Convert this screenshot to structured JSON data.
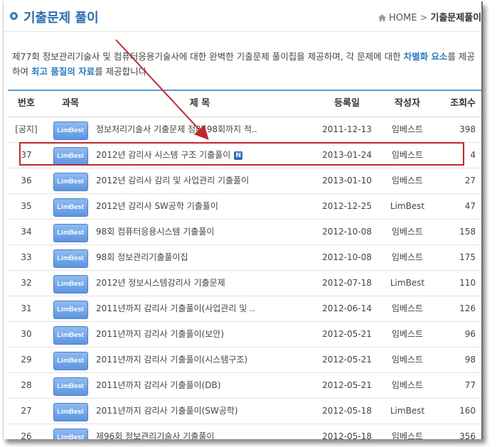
{
  "header": {
    "title": "기출문제 풀이",
    "breadcrumb_home": "HOME",
    "breadcrumb_sep": ">",
    "breadcrumb_current": "기출문제풀이"
  },
  "intro": {
    "line1_a": "제77회 정보관리기술사 및 컴퓨터응용기술사에 대한 완벽한 기출문제 풀이집을 제공하며, 각 문제에 대한 ",
    "line1_hl": "차별화 요소",
    "line1_b": "를 제공",
    "line2_a": "하여 ",
    "line2_hl": "최고 품질의 자료",
    "line2_b": "를 제공합니다."
  },
  "table": {
    "headers": {
      "no": "번호",
      "subject": "과목",
      "title": "제 목",
      "date": "등록일",
      "author": "작성자",
      "views": "조회수"
    },
    "rows": [
      {
        "no": "[공지]",
        "badge": "LimBest",
        "title": "정보처리기술사 기출문제 정리(98회까지 적..",
        "date": "2011-12-13",
        "author": "임베스트",
        "views": "398"
      },
      {
        "no": "37",
        "badge": "LimBest",
        "title": "2012년 감리사 시스템 구조 기출풀이",
        "new": "N",
        "date": "2013-01-24",
        "author": "임베스트",
        "views": "4"
      },
      {
        "no": "36",
        "badge": "LimBest",
        "title": "2012년 감리사 감리 및 사업관리 기출풀이",
        "date": "2013-01-10",
        "author": "임베스트",
        "views": "27"
      },
      {
        "no": "35",
        "badge": "LimBest",
        "title": "2012년 감리사 SW공학 기출풀이",
        "date": "2012-12-25",
        "author": "LimBest",
        "views": "47"
      },
      {
        "no": "34",
        "badge": "LimBest",
        "title": "98회 컴퓨터응용시스템 기출풀이",
        "date": "2012-10-08",
        "author": "임베스트",
        "views": "158"
      },
      {
        "no": "33",
        "badge": "LimBest",
        "title": "98회 정보관리기출풀이집",
        "date": "2012-10-08",
        "author": "임베스트",
        "views": "175"
      },
      {
        "no": "32",
        "badge": "LimBest",
        "title": "2012년 정보시스템감리사 기출문제",
        "date": "2012-07-18",
        "author": "LimBest",
        "views": "110"
      },
      {
        "no": "31",
        "badge": "LimBest",
        "title": "2011년까지 감리사 기출풀이(사업관리 및 ..",
        "date": "2012-06-14",
        "author": "임베스트",
        "views": "126"
      },
      {
        "no": "30",
        "badge": "LimBest",
        "title": "2011년까지 감리사 기출풀이(보안)",
        "date": "2012-05-21",
        "author": "임베스트",
        "views": "96"
      },
      {
        "no": "29",
        "badge": "LimBest",
        "title": "2011년까지 감리사 기출풀이(시스템구조)",
        "date": "2012-05-21",
        "author": "임베스트",
        "views": "98"
      },
      {
        "no": "28",
        "badge": "LimBest",
        "title": "2011년까지 감리사 기출풀이(DB)",
        "date": "2012-05-21",
        "author": "임베스트",
        "views": "77"
      },
      {
        "no": "27",
        "badge": "LimBest",
        "title": "2011년까지 감리사 기출풀이(SW공학)",
        "date": "2012-05-18",
        "author": "LimBest",
        "views": "160"
      },
      {
        "no": "26",
        "badge": "LimBest",
        "title": "제96회 정보관리기술사 기출풀이",
        "date": "2012-05-18",
        "author": "임베스트",
        "views": "356"
      }
    ]
  },
  "colors": {
    "accent": "#2b6cb0",
    "highlight_box": "#c0282d",
    "badge": "#5d95e0"
  }
}
